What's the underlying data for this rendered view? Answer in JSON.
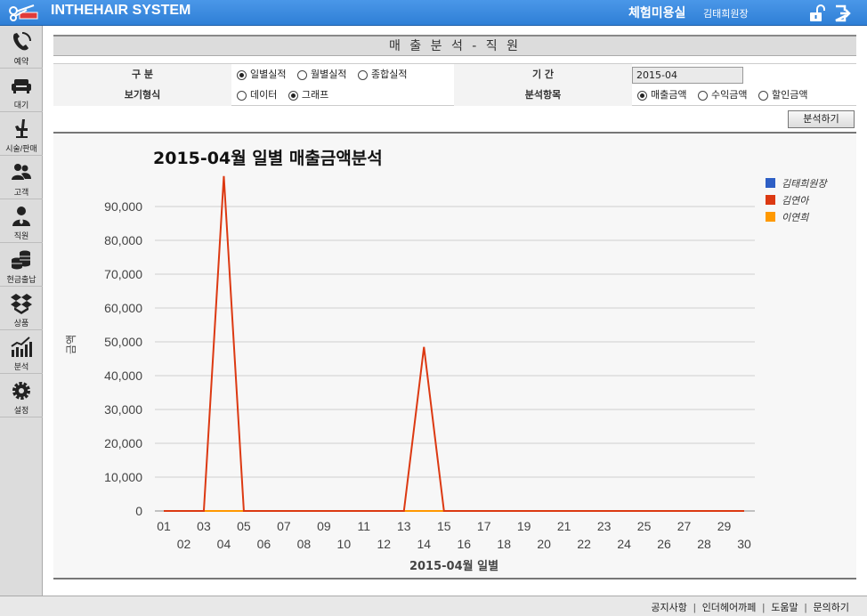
{
  "app": {
    "title": "INTHEHAIR SYSTEM",
    "shop_name": "체험미용실",
    "user_name": "김태희원장"
  },
  "sidebar": {
    "items": [
      {
        "label": "예약",
        "icon": "phone-icon"
      },
      {
        "label": "대기",
        "icon": "sofa-icon"
      },
      {
        "label": "시술/판매",
        "icon": "barber-chair-icon"
      },
      {
        "label": "고객",
        "icon": "customers-icon"
      },
      {
        "label": "직원",
        "icon": "staff-icon"
      },
      {
        "label": "현금출납",
        "icon": "coins-icon"
      },
      {
        "label": "상품",
        "icon": "boxes-icon"
      },
      {
        "label": "분석",
        "icon": "bar-chart-icon"
      },
      {
        "label": "설정",
        "icon": "gear-icon"
      }
    ]
  },
  "page": {
    "title": "매 출 분 석 - 직 원"
  },
  "form": {
    "category": {
      "label": "구 분",
      "options": [
        "일별실적",
        "월별실적",
        "종합실적"
      ],
      "selected": 0
    },
    "period": {
      "label": "기 간",
      "value": "2015-04"
    },
    "view_type": {
      "label": "보기형식",
      "options": [
        "데이터",
        "그래프"
      ],
      "selected": 1
    },
    "analysis_item": {
      "label": "분석항목",
      "options": [
        "매출금액",
        "수익금액",
        "할인금액"
      ],
      "selected": 0
    },
    "analyze_button": "분석하기"
  },
  "chart_data": {
    "type": "line",
    "title": "2015-04월 일별 매출금액분석",
    "xlabel": "2015-04월 일별",
    "ylabel": "금액",
    "ylim": [
      0,
      100000
    ],
    "yticks": [
      0,
      10000,
      20000,
      30000,
      40000,
      50000,
      60000,
      70000,
      80000,
      90000
    ],
    "ytick_labels": [
      "0",
      "10,000",
      "20,000",
      "30,000",
      "40,000",
      "50,000",
      "60,000",
      "70,000",
      "80,000",
      "90,000"
    ],
    "categories": [
      "01",
      "02",
      "03",
      "04",
      "05",
      "06",
      "07",
      "08",
      "09",
      "10",
      "11",
      "12",
      "13",
      "14",
      "15",
      "16",
      "17",
      "18",
      "19",
      "20",
      "21",
      "22",
      "23",
      "24",
      "25",
      "26",
      "27",
      "28",
      "29",
      "30"
    ],
    "legend_position": "top-right",
    "grid": true,
    "series": [
      {
        "name": "김태희원장",
        "color": "#2e5fc5",
        "values": [
          0,
          0,
          0,
          0,
          0,
          0,
          0,
          0,
          0,
          0,
          0,
          0,
          0,
          0,
          0,
          0,
          0,
          0,
          0,
          0,
          0,
          0,
          0,
          0,
          0,
          0,
          0,
          0,
          0,
          0
        ]
      },
      {
        "name": "김연아",
        "color": "#dc3912",
        "values": [
          0,
          0,
          0,
          99000,
          0,
          0,
          0,
          0,
          0,
          0,
          0,
          0,
          0,
          48500,
          0,
          0,
          0,
          0,
          0,
          0,
          0,
          0,
          0,
          0,
          0,
          0,
          0,
          0,
          0,
          0
        ]
      },
      {
        "name": "이연희",
        "color": "#ff9900",
        "values": [
          0,
          0,
          0,
          0,
          0,
          0,
          0,
          0,
          0,
          0,
          0,
          0,
          0,
          0,
          0,
          0,
          0,
          0,
          0,
          0,
          0,
          0,
          0,
          0,
          0,
          0,
          0,
          0,
          0,
          0
        ]
      }
    ]
  },
  "footer": {
    "links": [
      "공지사항",
      "인더헤어까페",
      "도움말",
      "문의하기"
    ]
  }
}
